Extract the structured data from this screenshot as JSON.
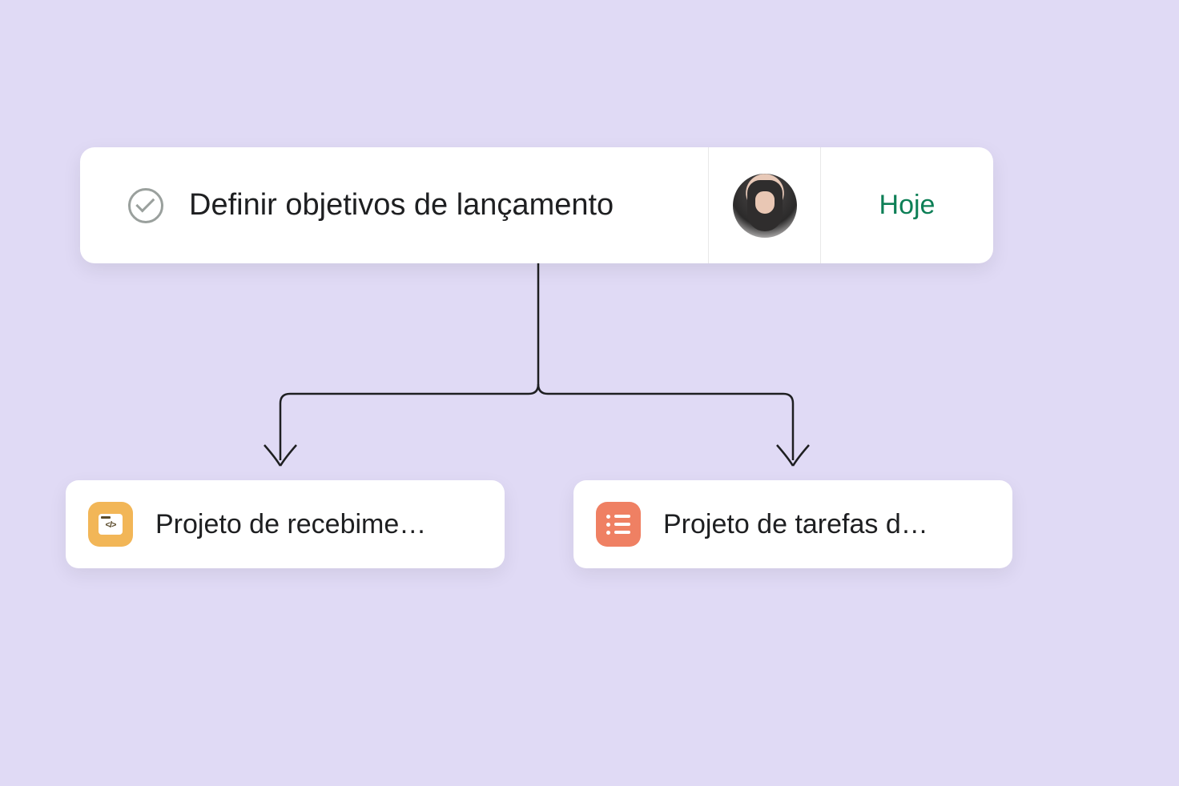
{
  "task": {
    "title": "Definir objetivos de lançamento",
    "due": "Hoje"
  },
  "projects": [
    {
      "title": "Projeto de recebime…",
      "icon": "code-window-icon",
      "color": "#f2b657"
    },
    {
      "title": "Projeto de tarefas d…",
      "icon": "list-icon",
      "color": "#ef8063"
    }
  ],
  "colors": {
    "background": "#e0daf5",
    "due_text": "#0d7f56"
  }
}
